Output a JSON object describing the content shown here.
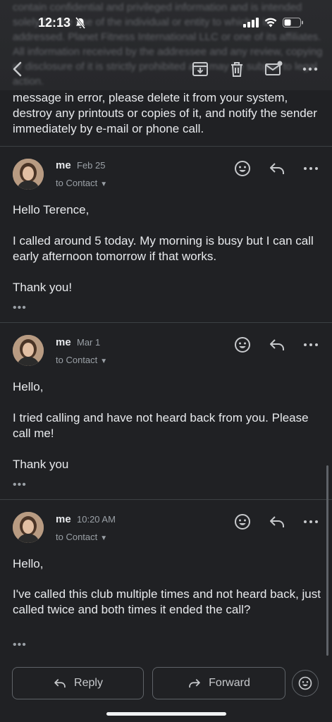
{
  "status": {
    "time": "12:13"
  },
  "header": {
    "blurred_text": "contain confidential and privileged information and is intended solely for the use of the individual or entity to which it is addressed. Planet Fitness International LLC or one of its affiliates. All information received by the addressee and any review, copying or disclosure of it is strictly prohibited and may be subject to legal action."
  },
  "quoted_text": "message in error, please delete it from your system, destroy any printouts or copies of it, and notify the sender immediately by e-mail or phone call.",
  "messages": [
    {
      "sender": "me",
      "date": "Feb 25",
      "to": "to Contact",
      "greeting": "Hello Terence,",
      "body": "I called around 5 today. My morning is busy but I can call early afternoon tomorrow if that works.",
      "signoff": "Thank you!",
      "more": "•••"
    },
    {
      "sender": "me",
      "date": "Mar 1",
      "to": "to Contact",
      "greeting": "Hello,",
      "body": "I tried calling and have not heard back from you. Please call me!",
      "signoff": "Thank you",
      "more": "•••"
    },
    {
      "sender": "me",
      "date": "10:20 AM",
      "to": "to Contact",
      "greeting": "Hello,",
      "body": "I've called this club multiple times and not heard back, just called twice and both times it ended the call?",
      "signoff": "",
      "more": "•••"
    }
  ],
  "actions": {
    "reply": "Reply",
    "forward": "Forward"
  },
  "colors": {
    "background": "#202124",
    "text": "#e8eaed",
    "muted": "#9aa0a6"
  }
}
